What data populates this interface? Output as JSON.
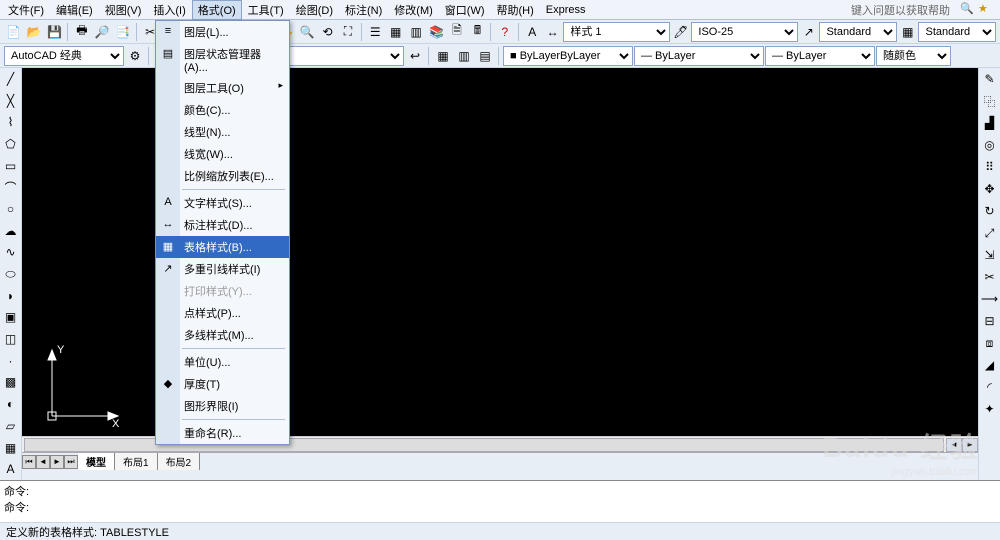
{
  "menubar": {
    "items": [
      "文件(F)",
      "编辑(E)",
      "视图(V)",
      "插入(I)",
      "格式(O)",
      "工具(T)",
      "绘图(D)",
      "标注(N)",
      "修改(M)",
      "窗口(W)",
      "帮助(H)",
      "Express"
    ],
    "active_index": 4,
    "help_hint": "键入问题以获取帮助"
  },
  "toolbar1": {
    "workspace": "AutoCAD 经典"
  },
  "toolbar2": {
    "style_label": "样式 1",
    "iso": "ISO-25",
    "standard1": "Standard",
    "standard2": "Standard"
  },
  "toolbar3": {
    "bylayer1": "ByLayer",
    "bylayer2": "ByLayer",
    "bylayer3": "ByLayer",
    "color": "随颜色"
  },
  "dropdown": {
    "items": [
      {
        "label": "图层(L)...",
        "icon": "≡"
      },
      {
        "label": "图层状态管理器(A)...",
        "icon": "▤"
      },
      {
        "label": "图层工具(O)",
        "arrow": true
      },
      {
        "label": "颜色(C)..."
      },
      {
        "label": "线型(N)..."
      },
      {
        "label": "线宽(W)..."
      },
      {
        "label": "比例缩放列表(E)..."
      },
      {
        "sep": true
      },
      {
        "label": "文字样式(S)...",
        "icon": "A"
      },
      {
        "label": "标注样式(D)...",
        "icon": "↔"
      },
      {
        "label": "表格样式(B)...",
        "icon": "▦",
        "highlighted": true
      },
      {
        "label": "多重引线样式(I)",
        "icon": "↗"
      },
      {
        "label": "打印样式(Y)...",
        "disabled": true
      },
      {
        "label": "点样式(P)..."
      },
      {
        "label": "多线样式(M)..."
      },
      {
        "sep": true
      },
      {
        "label": "单位(U)..."
      },
      {
        "label": "厚度(T)",
        "icon": "◆"
      },
      {
        "label": "图形界限(I)"
      },
      {
        "sep": true
      },
      {
        "label": "重命名(R)..."
      }
    ]
  },
  "canvas": {
    "axis_x": "X",
    "axis_y": "Y"
  },
  "tabs": {
    "items": [
      "模型",
      "布局1",
      "布局2"
    ],
    "active_index": 0
  },
  "cmd": {
    "line1": "命令:",
    "line2": "命令:"
  },
  "status": {
    "text": "定义新的表格样式: TABLESTYLE"
  },
  "watermark": {
    "brand": "Baidu 经验",
    "url": "jingyan.baidu.com"
  }
}
